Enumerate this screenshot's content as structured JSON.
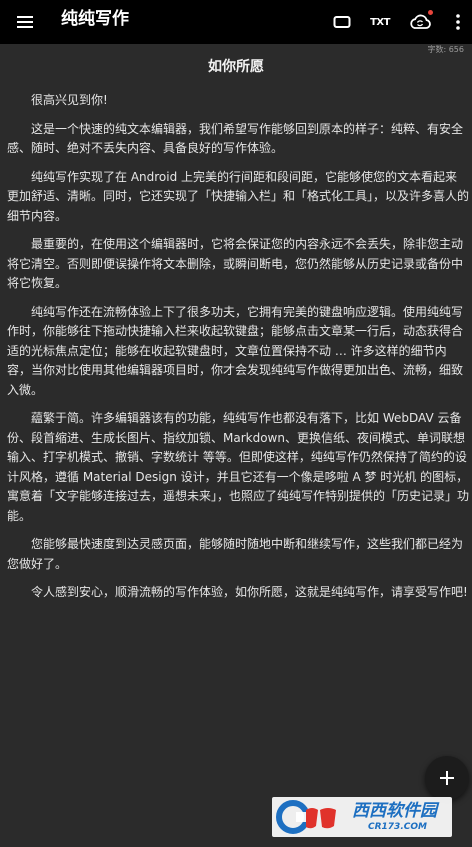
{
  "toolbar": {
    "title": "纯纯写作",
    "txt_label": "TXT",
    "colors": {
      "bar": "#000000",
      "cloud_badge": "#e8453c"
    },
    "icons": [
      "menu-icon",
      "fullscreen-icon",
      "txt-format-icon",
      "cloud-sync-icon",
      "more-vert-icon"
    ]
  },
  "document": {
    "word_count": "字数: 656",
    "title": "如你所愿",
    "paragraphs": [
      "很高兴见到你!",
      "这是一个快速的纯文本编辑器，我们希望写作能够回到原本的样子：纯粹、有安全感、随时、绝对不丢失内容、具备良好的写作体验。",
      "纯纯写作实现了在 Android 上完美的行间距和段间距，它能够使您的文本看起来更加舒适、清晰。同时，它还实现了「快捷输入栏」和「格式化工具」，以及许多喜人的细节内容。",
      "最重要的，在使用这个编辑器时，它将会保证您的内容永远不会丢失，除非您主动将它清空。否则即便误操作将文本删除，或瞬间断电，您仍然能够从历史记录或备份中将它恢复。",
      "纯纯写作还在流畅体验上下了很多功夫，它拥有完美的键盘响应逻辑。使用纯纯写作时，你能够往下拖动快捷输入栏来收起软键盘；能够点击文章某一行后，动态获得合适的光标焦点定位；能够在收起软键盘时，文章位置保持不动 … 许多这样的细节内容，当你对比使用其他编辑器项目时，你才会发现纯纯写作做得更加出色、流畅，细致入微。",
      "藴繁于简。许多编辑器该有的功能，纯纯写作也都没有落下，比如 WebDAV 云备份、段首缩进、生成长图片、指纹加锁、Markdown、更换信纸、夜间模式、单词联想输入、打字机模式、撤销、字数统计 等等。但即使这样，纯纯写作仍然保持了简约的设计风格，遵循 Material Design 设计，并且它还有一个像是哆啦 A 梦 时光机 的图标，寓意着「文字能够连接过去，遥想未来」，也照应了纯纯写作特别提供的「历史记录」功能。",
      "您能够最快速度到达灵感页面，能够随时随地中断和继续写作，这些我们都已经为您做好了。",
      "令人感到安心，顺滑流畅的写作体验，如你所愿，这就是纯纯写作，请享受写作吧!"
    ]
  },
  "fab": {
    "icon": "add-icon"
  },
  "watermark": {
    "brand": "西西软件园",
    "url": "CR173.COM",
    "brand_color": "#1d6fc1"
  }
}
